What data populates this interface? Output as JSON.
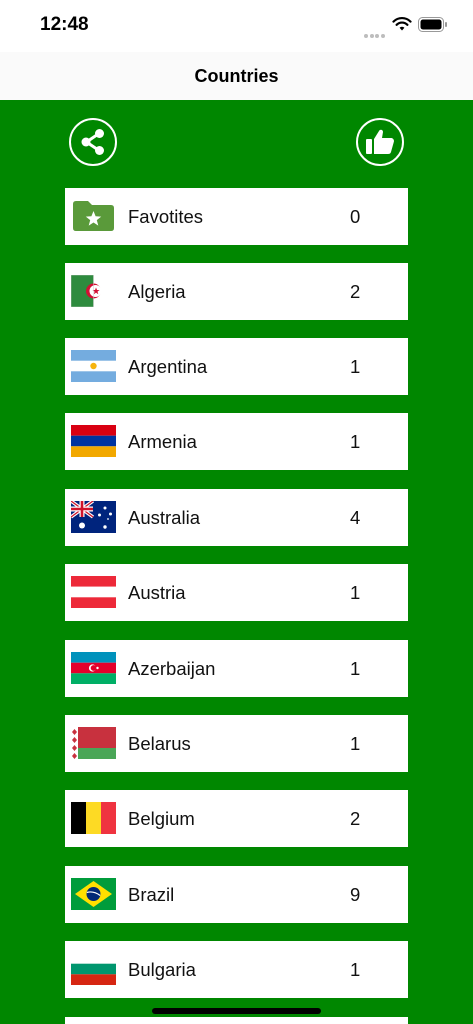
{
  "status_bar": {
    "time": "12:48"
  },
  "nav": {
    "title": "Countries"
  },
  "toolbar": {
    "share_icon": "share-icon",
    "like_icon": "thumbs-up-icon"
  },
  "countries": [
    {
      "name": "Favotites",
      "count": "0",
      "flag": "favorites-folder-icon"
    },
    {
      "name": "Algeria",
      "count": "2",
      "flag": "algeria-flag"
    },
    {
      "name": "Argentina",
      "count": "1",
      "flag": "argentina-flag"
    },
    {
      "name": "Armenia",
      "count": "1",
      "flag": "armenia-flag"
    },
    {
      "name": "Australia",
      "count": "4",
      "flag": "australia-flag"
    },
    {
      "name": "Austria",
      "count": "1",
      "flag": "austria-flag"
    },
    {
      "name": "Azerbaijan",
      "count": "1",
      "flag": "azerbaijan-flag"
    },
    {
      "name": "Belarus",
      "count": "1",
      "flag": "belarus-flag"
    },
    {
      "name": "Belgium",
      "count": "2",
      "flag": "belgium-flag"
    },
    {
      "name": "Brazil",
      "count": "9",
      "flag": "brazil-flag"
    },
    {
      "name": "Bulgaria",
      "count": "1",
      "flag": "bulgaria-flag"
    }
  ],
  "colors": {
    "background": "#008700",
    "row": "#ffffff",
    "favorites_icon": "#5a9a3a"
  }
}
